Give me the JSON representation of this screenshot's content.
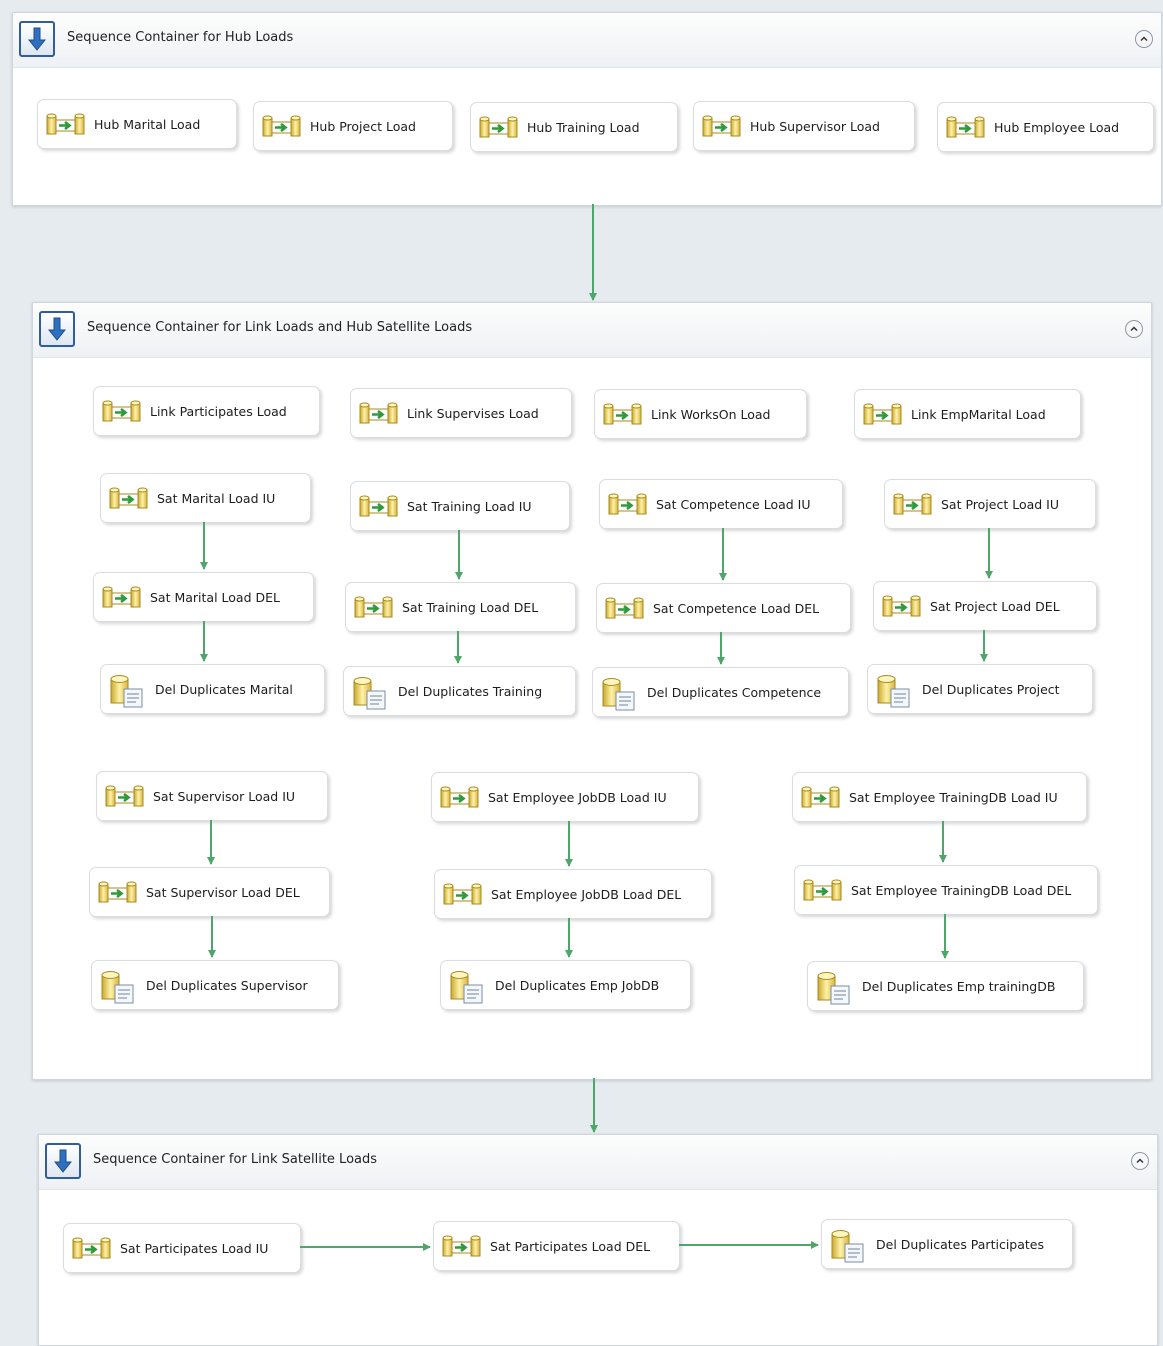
{
  "containers": [
    {
      "title": "Sequence Container for Hub Loads",
      "tasks": [
        {
          "label": "Hub Marital Load",
          "icon": "data-flow-task-icon"
        },
        {
          "label": "Hub Project Load",
          "icon": "data-flow-task-icon"
        },
        {
          "label": "Hub Training Load",
          "icon": "data-flow-task-icon"
        },
        {
          "label": "Hub Supervisor Load",
          "icon": "data-flow-task-icon"
        },
        {
          "label": "Hub Employee Load",
          "icon": "data-flow-task-icon"
        }
      ]
    },
    {
      "title": "Sequence Container for Link Loads and Hub Satellite Loads",
      "tasks": [
        {
          "label": "Link Participates Load",
          "icon": "data-flow-task-icon"
        },
        {
          "label": "Link Supervises Load",
          "icon": "data-flow-task-icon"
        },
        {
          "label": "Link WorksOn Load",
          "icon": "data-flow-task-icon"
        },
        {
          "label": "Link EmpMarital Load",
          "icon": "data-flow-task-icon"
        },
        {
          "label": "Sat Marital Load IU",
          "icon": "data-flow-task-icon"
        },
        {
          "label": "Sat Training Load IU",
          "icon": "data-flow-task-icon"
        },
        {
          "label": "Sat Competence Load IU",
          "icon": "data-flow-task-icon"
        },
        {
          "label": "Sat Project Load IU",
          "icon": "data-flow-task-icon"
        },
        {
          "label": "Sat Marital Load DEL",
          "icon": "data-flow-task-icon"
        },
        {
          "label": "Sat Training Load DEL",
          "icon": "data-flow-task-icon"
        },
        {
          "label": "Sat Competence Load DEL",
          "icon": "data-flow-task-icon"
        },
        {
          "label": "Sat Project Load DEL",
          "icon": "data-flow-task-icon"
        },
        {
          "label": "Del Duplicates Marital",
          "icon": "execute-sql-task-icon"
        },
        {
          "label": "Del Duplicates Training",
          "icon": "execute-sql-task-icon"
        },
        {
          "label": "Del Duplicates Competence",
          "icon": "execute-sql-task-icon"
        },
        {
          "label": "Del Duplicates Project",
          "icon": "execute-sql-task-icon"
        },
        {
          "label": "Sat Supervisor Load IU",
          "icon": "data-flow-task-icon"
        },
        {
          "label": "Sat Employee JobDB Load IU",
          "icon": "data-flow-task-icon"
        },
        {
          "label": "Sat Employee TrainingDB Load IU",
          "icon": "data-flow-task-icon"
        },
        {
          "label": "Sat Supervisor Load DEL",
          "icon": "data-flow-task-icon"
        },
        {
          "label": "Sat Employee JobDB Load DEL",
          "icon": "data-flow-task-icon"
        },
        {
          "label": "Sat Employee TrainingDB Load DEL",
          "icon": "data-flow-task-icon"
        },
        {
          "label": "Del Duplicates Supervisor",
          "icon": "execute-sql-task-icon"
        },
        {
          "label": "Del Duplicates Emp JobDB",
          "icon": "execute-sql-task-icon"
        },
        {
          "label": "Del Duplicates Emp trainingDB",
          "icon": "execute-sql-task-icon"
        }
      ]
    },
    {
      "title": "Sequence Container for Link Satellite Loads",
      "tasks": [
        {
          "label": "Sat Participates Load IU",
          "icon": "data-flow-task-icon"
        },
        {
          "label": "Sat Participates Load DEL",
          "icon": "data-flow-task-icon"
        },
        {
          "label": "Del Duplicates Participates",
          "icon": "execute-sql-task-icon"
        }
      ]
    }
  ],
  "colors": {
    "canvas": "#e6ebf0",
    "precedence_arrow": "#4fa66a",
    "container_border": "#2f5e9a"
  }
}
